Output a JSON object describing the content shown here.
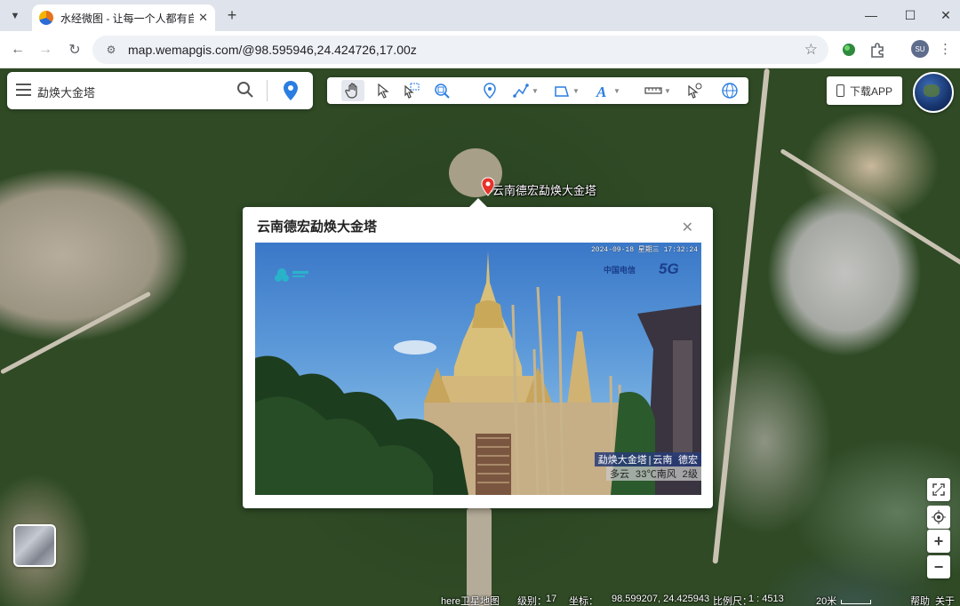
{
  "browser": {
    "tab_title": "水经微图 - 让每一个人都有自己",
    "url": "map.wemapgis.com/@98.595946,24.424726,17.00z",
    "avatar_initials": "SU"
  },
  "search": {
    "query": "勐焕大金塔"
  },
  "toolbar": {
    "tools": [
      "pan-hand-icon",
      "select-arrow-icon",
      "box-select-icon",
      "zoom-area-icon",
      "point-marker-icon",
      "polyline-icon",
      "polygon-icon",
      "text-icon",
      "measure-ruler-icon",
      "identify-icon",
      "globe-icon"
    ]
  },
  "download_app": {
    "label": "下载APP"
  },
  "map": {
    "marker_label": "云南德宏勐焕大金塔"
  },
  "popup": {
    "title": "云南德宏勐焕大金塔",
    "camera": {
      "timestamp": "2024-09-18 星期三 17:32:24",
      "carrier": "中国电信",
      "network": "5G",
      "caption_line1": "勐焕大金塔|云南 德宏",
      "caption_line2": "多云 33℃南风 2级"
    }
  },
  "status": {
    "layer_name": "here卫星地图",
    "level_label": "级别：",
    "level": "17",
    "coord_label": "坐标：",
    "coords": "98.599207, 24.425943",
    "scale_label": "比例尺：",
    "scale": "1 : 4513",
    "scale_bar": "20米",
    "help": "帮助",
    "about": "关于"
  }
}
